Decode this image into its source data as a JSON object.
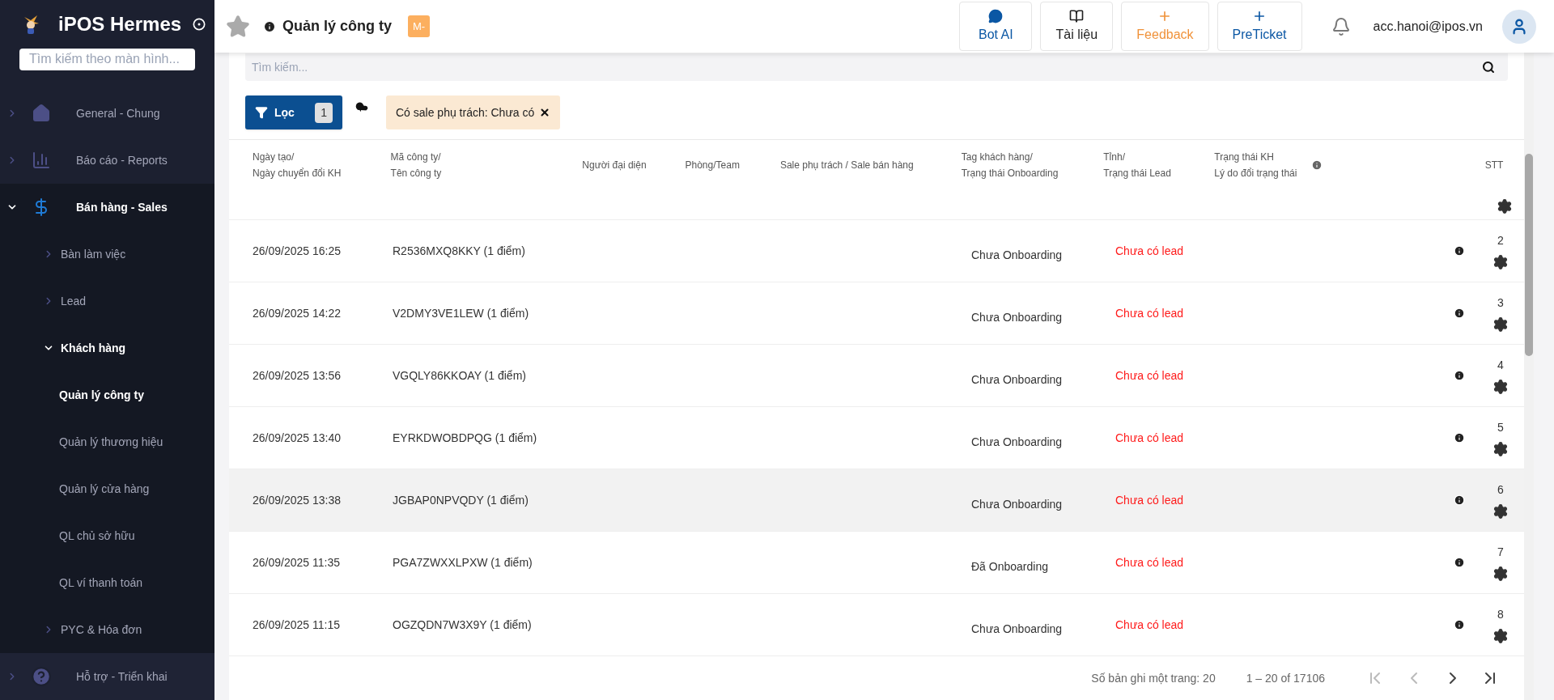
{
  "sidebar": {
    "app_name": "iPOS Hermes",
    "search": {
      "placeholder": "Tìm kiếm theo màn hình..."
    },
    "items": [
      {
        "label": "General - Chung",
        "expanded": false
      },
      {
        "label": "Báo cáo - Reports",
        "expanded": false
      },
      {
        "label": "Bán hàng - Sales",
        "expanded": true,
        "children": [
          {
            "label": "Bàn làm việc",
            "expanded": false
          },
          {
            "label": "Lead",
            "expanded": false
          },
          {
            "label": "Khách hàng",
            "expanded": true,
            "children": [
              {
                "label": "Quản lý công ty",
                "selected": true
              },
              {
                "label": "Quản lý thương hiệu",
                "selected": false
              },
              {
                "label": "Quản lý cửa hàng",
                "selected": false
              },
              {
                "label": "QL chủ sở hữu",
                "selected": false
              },
              {
                "label": "QL ví thanh toán",
                "selected": false
              }
            ]
          },
          {
            "label": "PYC & Hóa đơn",
            "expanded": false
          }
        ]
      },
      {
        "label": "Hỗ trợ - Triển khai",
        "expanded": false
      }
    ]
  },
  "header": {
    "title": "Quản lý công ty",
    "badge": "M-",
    "buttons": [
      {
        "label": "Bot AI",
        "color": "#0b57a4"
      },
      {
        "label": "Tài liệu",
        "color": "#222222"
      },
      {
        "label": "Feedback",
        "color": "#f0923a"
      },
      {
        "label": "PreTicket",
        "color": "#0b57a4"
      }
    ],
    "user": "acc.hanoi@ipos.vn"
  },
  "search": {
    "placeholder": "Tìm kiếm..."
  },
  "filter": {
    "label": "Lọc",
    "count": "1",
    "chips": [
      {
        "label": "Có sale phụ trách: Chưa có"
      }
    ]
  },
  "table": {
    "columns": [
      [
        "Ngày tạo/",
        "Ngày chuyển đổi KH"
      ],
      [
        "Mã công ty/",
        "Tên công ty"
      ],
      [
        "Người đại diện"
      ],
      [
        "Phòng/Team"
      ],
      [
        "Sale phụ trách / Sale bán hàng"
      ],
      [
        "Tag khách hàng/",
        "Trạng thái Onboarding"
      ],
      [
        "Tỉnh/",
        "Trạng thái Lead"
      ],
      [
        "Trạng thái KH",
        "Lý do đổi trạng thái"
      ],
      [
        "STT"
      ]
    ],
    "rows": [
      {
        "date": "26/09/2025 16:25",
        "code": "R2536MXQ8KKY (1 điểm)",
        "tag": "Chưa Onboarding",
        "lead": "Chưa có lead",
        "stt": "2",
        "selected": false
      },
      {
        "date": "26/09/2025 14:22",
        "code": "V2DMY3VE1LEW (1 điểm)",
        "tag": "Chưa Onboarding",
        "lead": "Chưa có lead",
        "stt": "3",
        "selected": false
      },
      {
        "date": "26/09/2025 13:56",
        "code": "VGQLY86KKOAY (1 điểm)",
        "tag": "Chưa Onboarding",
        "lead": "Chưa có lead",
        "stt": "4",
        "selected": false
      },
      {
        "date": "26/09/2025 13:40",
        "code": "EYRKDWOBDPQG (1 điểm)",
        "tag": "Chưa Onboarding",
        "lead": "Chưa có lead",
        "stt": "5",
        "selected": false
      },
      {
        "date": "26/09/2025 13:38",
        "code": "JGBAP0NPVQDY (1 điểm)",
        "tag": "Chưa Onboarding",
        "lead": "Chưa có lead",
        "stt": "6",
        "selected": true
      },
      {
        "date": "26/09/2025 11:35",
        "code": "PGA7ZWXXLPXW (1 điểm)",
        "tag": "Đã Onboarding",
        "lead": "Chưa có lead",
        "stt": "7",
        "selected": false
      },
      {
        "date": "26/09/2025 11:15",
        "code": "OGZQDN7W3X9Y (1 điểm)",
        "tag": "Chưa Onboarding",
        "lead": "Chưa có lead",
        "stt": "8",
        "selected": false
      }
    ]
  },
  "pagination": {
    "page_size": "Số bản ghi một trang: 20",
    "range": "1 – 20 of 17106"
  }
}
